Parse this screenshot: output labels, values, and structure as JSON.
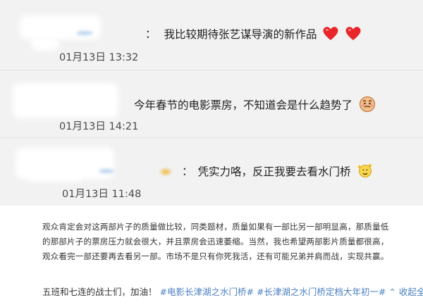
{
  "comments": [
    {
      "separator": "：",
      "text": "我比较期待张艺谋导演的新作品",
      "emoji": [
        "red-heart-emoji",
        "red-heart-emoji"
      ],
      "time": "01月13日 13:32"
    },
    {
      "separator": "",
      "text": "今年春节的电影票房，不知道会是什么趋势了",
      "emoji": [
        "thinking-face-emoji"
      ],
      "time": "01月13日 14:21"
    },
    {
      "separator": "：",
      "text": "凭实力咯，反正我要去看水门桥",
      "emoji": [
        "sparkle-face-emoji"
      ],
      "time": "01月13日 11:48"
    }
  ],
  "post": {
    "lines": [
      "观众肯定会对这两部片子的质量做比较，同类题材，质量如果有一部比另一部明显高，那质量低",
      "的那部片子的票房压力就会很大，并且票房会迅速萎缩。当然，我也希望两部影片质量都很高，",
      "观众看完一部还要再去看另一部。市场不是只有你死我活，还有可能兄弟并肩而战，实现共赢。"
    ],
    "footer_text": "五班和七连的战士们，加油！",
    "hashtags": [
      "#电影长津湖之水门桥#",
      "#长津湖之水门桥定档大年初一#"
    ],
    "collapse_label": "收起全文",
    "collapse_arrow": "⌃"
  }
}
